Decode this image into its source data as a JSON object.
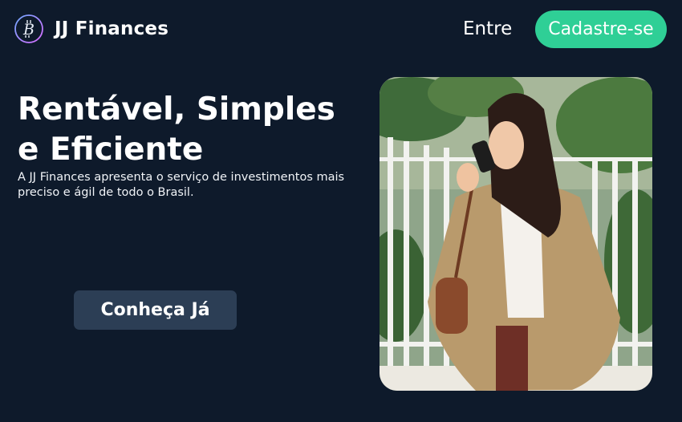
{
  "header": {
    "brand": "JJ Finances",
    "logo_icon": "bitcoin-b-icon",
    "login_link": "Entre",
    "signup_button": "Cadastre-se"
  },
  "hero": {
    "headline": "Rentável, Simples e Eficiente",
    "subtitle": "A JJ Finances apresenta o serviço de investimentos mais preciso e ágil de todo o Brasil.",
    "cta_button": "Conheça Já",
    "image_alt": "woman-on-phone-photo"
  },
  "colors": {
    "background": "#0e1a2b",
    "accent": "#2fcf96",
    "cta_background": "#2c3e55",
    "logo_gradient": [
      "#6fa8ff",
      "#d86bff"
    ]
  }
}
